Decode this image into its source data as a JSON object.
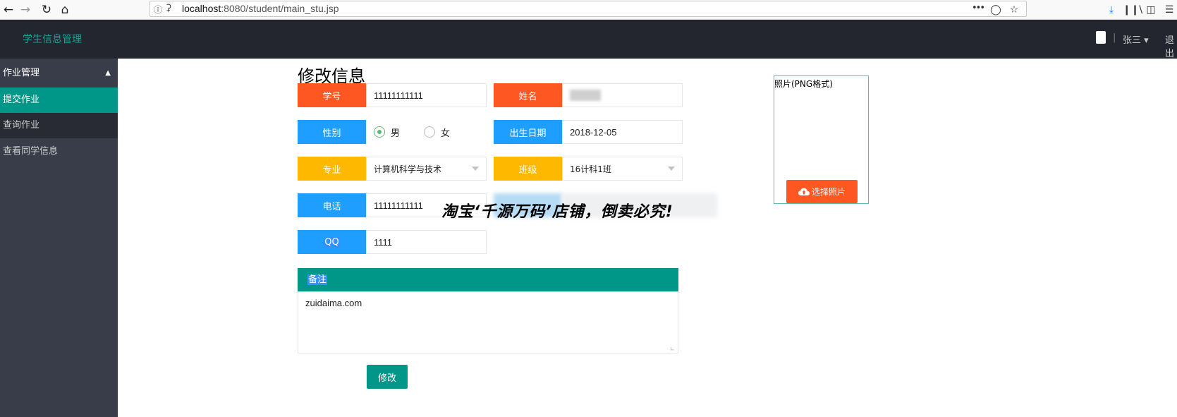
{
  "browser": {
    "url_host": "localhost",
    "url_rest": ":8080/student/main_stu.jsp",
    "more_glyph": "•••"
  },
  "app": {
    "brand": "学生信息管理",
    "user": "张三",
    "logout": "退出"
  },
  "sidebar": {
    "group": "作业管理",
    "items": [
      {
        "label": "提交作业"
      },
      {
        "label": "查询作业"
      },
      {
        "label": "查看同学信息"
      }
    ]
  },
  "form": {
    "title": "修改信息",
    "student_id": {
      "label": "学号",
      "value": "11111111111"
    },
    "name": {
      "label": "姓名",
      "value": ""
    },
    "gender": {
      "label": "性别",
      "options": [
        "男",
        "女"
      ],
      "selected": "男"
    },
    "birth": {
      "label": "出生日期",
      "value": "2018-12-05"
    },
    "major": {
      "label": "专业",
      "value": "计算机科学与技术"
    },
    "class": {
      "label": "班级",
      "value": "16计科1班"
    },
    "phone": {
      "label": "电话",
      "value": "11111111111"
    },
    "qq": {
      "label": "QQ",
      "value": "1111"
    },
    "remark": {
      "label": "备注",
      "value": "zuidaima.com"
    },
    "submit": "修改"
  },
  "photo": {
    "label": "照片(PNG格式)",
    "button": "选择照片"
  },
  "watermark": "淘宝‘千源万码’店铺，倒卖必究!",
  "colors": {
    "header": "#23262e",
    "sidebar": "#393d49",
    "accent": "#009688",
    "red": "#ff5722",
    "blue": "#1e9fff",
    "yellow": "#ffb800"
  }
}
